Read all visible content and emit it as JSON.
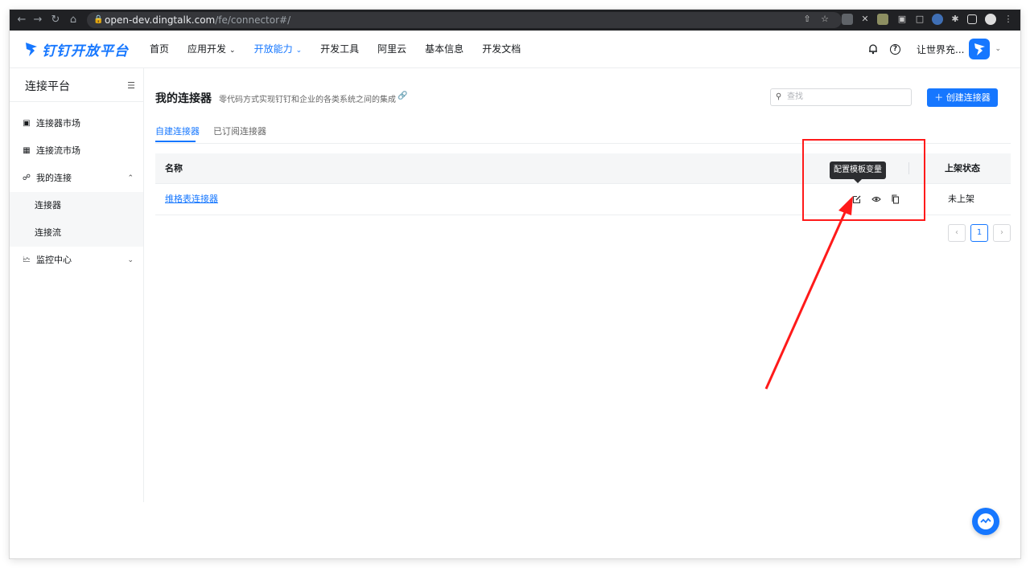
{
  "browser": {
    "url_host": "open-dev.dingtalk.com",
    "url_path": "/fe/connector#/"
  },
  "header": {
    "logo_text": "钉钉开放平台",
    "nav": [
      {
        "label": "首页",
        "has_caret": false
      },
      {
        "label": "应用开发",
        "has_caret": true
      },
      {
        "label": "开放能力",
        "has_caret": true,
        "active": true
      },
      {
        "label": "开发工具",
        "has_caret": false
      },
      {
        "label": "阿里云",
        "has_caret": false
      },
      {
        "label": "基本信息",
        "has_caret": false
      },
      {
        "label": "开发文档",
        "has_caret": false
      }
    ],
    "username": "让世界充...",
    "icons": [
      "bell-icon",
      "help-icon"
    ]
  },
  "sidebar": {
    "title": "连接平台",
    "items": [
      {
        "label": "连接器市场",
        "icon": "shop-icon"
      },
      {
        "label": "连接流市场",
        "icon": "grid-icon"
      },
      {
        "label": "我的连接",
        "icon": "link-icon",
        "expanded": true
      },
      {
        "label": "连接器",
        "sub": true
      },
      {
        "label": "连接流",
        "sub": true
      },
      {
        "label": "监控中心",
        "icon": "chart-icon",
        "expanded": false
      }
    ]
  },
  "main": {
    "title": "我的连接器",
    "description": "零代码方式实现钉钉和企业的各类系统之间的集成",
    "search_placeholder": "查找",
    "create_button": "创建连接器",
    "tabs": [
      {
        "label": "自建连接器",
        "active": true
      },
      {
        "label": "已订阅连接器",
        "active": false
      }
    ],
    "table": {
      "columns": [
        "名称",
        "上架状态"
      ],
      "rows": [
        {
          "name": "维格表连接器",
          "status": "未上架"
        }
      ]
    },
    "tooltip": "配置模板变量",
    "pagination": {
      "current": "1"
    }
  },
  "colors": {
    "accent": "#1677ff",
    "annotation": "#ff1a1a"
  }
}
